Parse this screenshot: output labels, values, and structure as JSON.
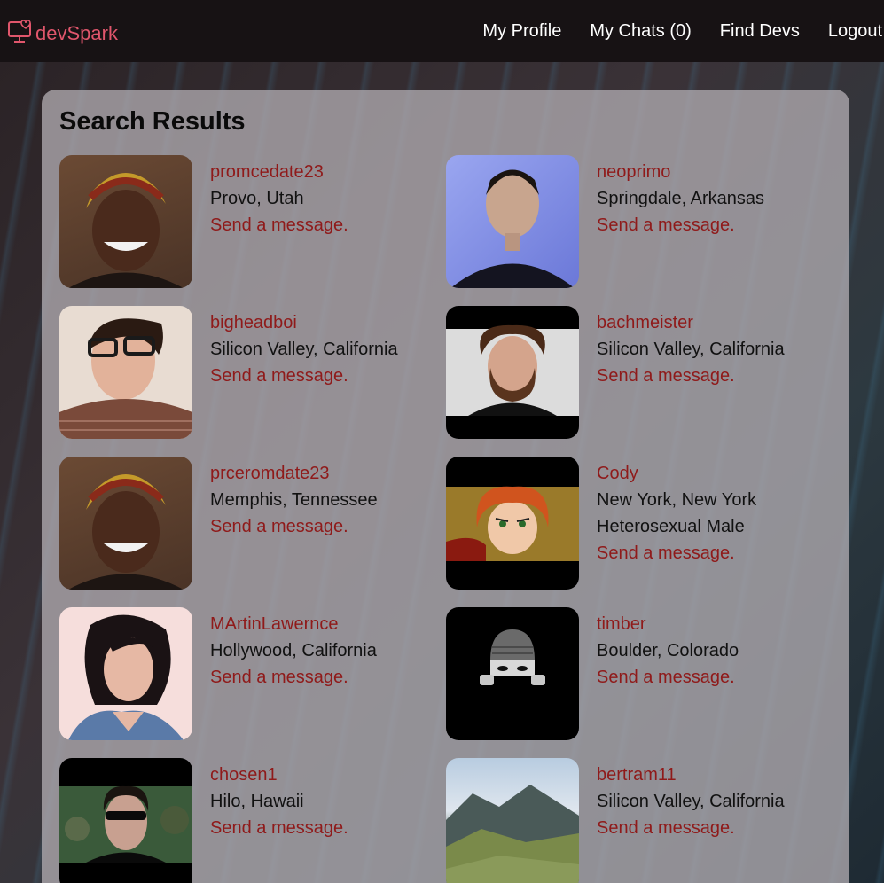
{
  "app": {
    "brand": "devSpark"
  },
  "nav": {
    "profile": "My Profile",
    "chats": "My Chats (0)",
    "find": "Find Devs",
    "logout": "Logout"
  },
  "page": {
    "title": "Search Results"
  },
  "results": [
    {
      "username": "promcedate23",
      "location": "Provo, Utah",
      "message": "Send a message."
    },
    {
      "username": "neoprimo",
      "location": "Springdale, Arkansas",
      "message": "Send a message."
    },
    {
      "username": "bigheadboi",
      "location": "Silicon Valley, California",
      "message": "Send a message."
    },
    {
      "username": "bachmeister",
      "location": "Silicon Valley, California",
      "message": "Send a message."
    },
    {
      "username": "prceromdate23",
      "location": "Memphis, Tennessee",
      "message": "Send a message."
    },
    {
      "username": "Cody",
      "location": "New York, New York",
      "extra": "Heterosexual Male",
      "message": "Send a message."
    },
    {
      "username": "MArtinLawernce",
      "location": "Hollywood, California",
      "message": "Send a message."
    },
    {
      "username": "timber",
      "location": "Boulder, Colorado",
      "message": "Send a message."
    },
    {
      "username": "chosen1",
      "location": "Hilo, Hawaii",
      "message": "Send a message."
    },
    {
      "username": "bertram11",
      "location": "Silicon Valley, California",
      "message": "Send a message."
    }
  ],
  "colors": {
    "brand": "#e0566c",
    "link": "#8f1a1a",
    "navbar": "#171214"
  }
}
